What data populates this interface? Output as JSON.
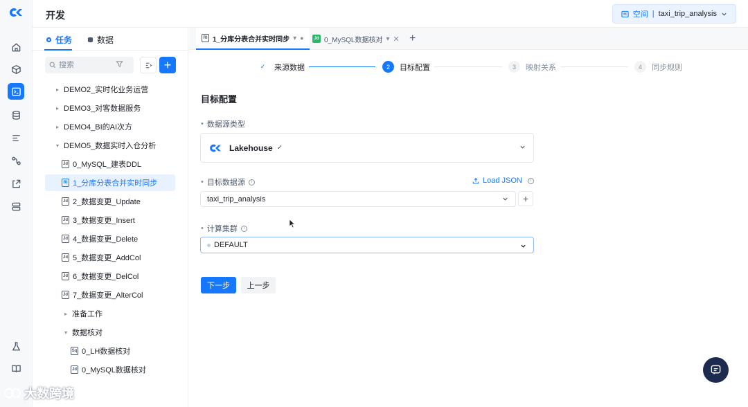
{
  "topbar": {
    "title": "开发",
    "space_label": "空间",
    "space_value": "taxi_trip_analysis"
  },
  "panel": {
    "tabs": [
      {
        "label": "任务"
      },
      {
        "label": "数据"
      }
    ],
    "search_placeholder": "搜索",
    "tree": [
      {
        "label": "DEMO2_实时化业务运营",
        "type": "folder",
        "expanded": false
      },
      {
        "label": "DEMO3_对客数据服务",
        "type": "folder",
        "expanded": false
      },
      {
        "label": "DEMO4_BI的AI次方",
        "type": "folder",
        "expanded": false
      },
      {
        "label": "DEMO5_数据实时入仓分析",
        "type": "folder",
        "expanded": true
      },
      {
        "label": "0_MySQL_建表DDL",
        "type": "file",
        "badge": "Jd"
      },
      {
        "label": "1_分库分表合并实时同步",
        "type": "file",
        "badge": "RI",
        "selected": true
      },
      {
        "label": "2_数据变更_Update",
        "type": "file",
        "badge": "Jd"
      },
      {
        "label": "3_数据变更_Insert",
        "type": "file",
        "badge": "Jd"
      },
      {
        "label": "4_数据变更_Delete",
        "type": "file",
        "badge": "Jd"
      },
      {
        "label": "5_数据变更_AddCol",
        "type": "file",
        "badge": "Jd"
      },
      {
        "label": "6_数据变更_DelCol",
        "type": "file",
        "badge": "Jd"
      },
      {
        "label": "7_数据变更_AlterCol",
        "type": "file",
        "badge": "Jd"
      },
      {
        "label": "准备工作",
        "type": "folder",
        "expanded": false
      },
      {
        "label": "数据核对",
        "type": "folder",
        "expanded": true
      },
      {
        "label": "0_LH数据核对",
        "type": "file",
        "badge": "Sq"
      },
      {
        "label": "0_MySQL数据核对",
        "type": "file",
        "badge": "Jd"
      }
    ]
  },
  "editor_tabs": [
    {
      "label": "1_分库分表合并实时同步",
      "badge": "RI",
      "active": true
    },
    {
      "label": "0_MySQL数据核对",
      "badge": "Jd",
      "active": false
    }
  ],
  "steps": [
    {
      "num": "✓",
      "label": "来源数据",
      "state": "done"
    },
    {
      "num": "2",
      "label": "目标配置",
      "state": "current"
    },
    {
      "num": "3",
      "label": "映射关系",
      "state": "todo"
    },
    {
      "num": "4",
      "label": "同步规则",
      "state": "todo"
    }
  ],
  "form": {
    "section_title": "目标配置",
    "datasource_type_label": "数据源类型",
    "datasource_type_value": "Lakehouse",
    "target_source_label": "目标数据源",
    "load_json_label": "Load JSON",
    "target_source_value": "taxi_trip_analysis",
    "cluster_label": "计算集群",
    "cluster_value": "DEFAULT",
    "next_label": "下一步",
    "prev_label": "上一步"
  },
  "watermark": "大数跨境",
  "colors": {
    "accent": "#1677ff",
    "fab": "#1d2b4f",
    "selected_bg": "#e8f1ff"
  }
}
